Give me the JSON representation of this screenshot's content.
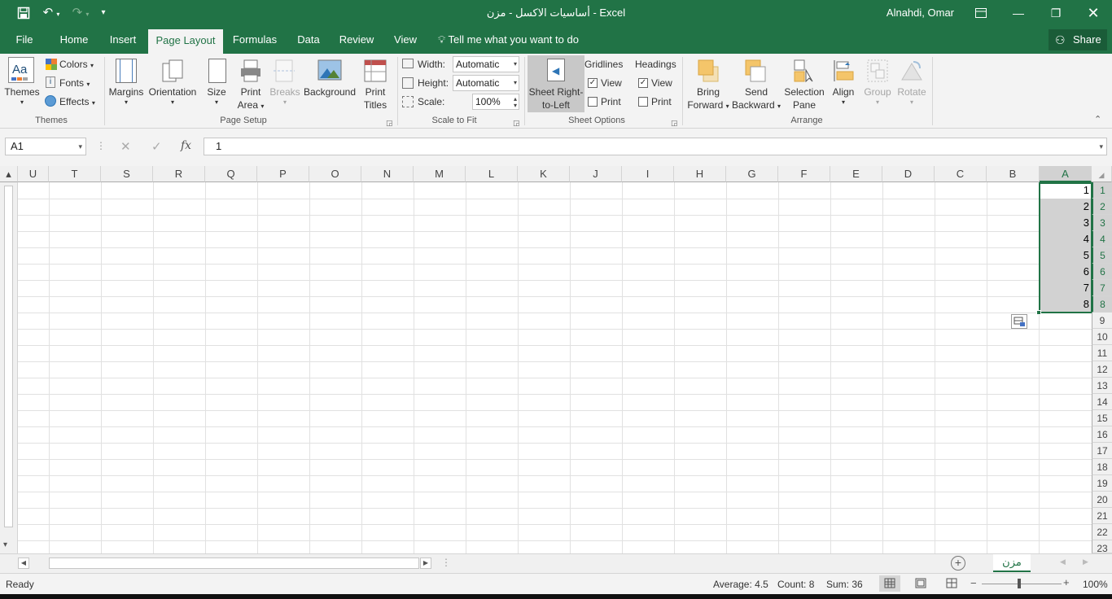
{
  "titlebar": {
    "title": "أساسيات الاكسل - مزن - Excel",
    "user": "Alnahdi, Omar"
  },
  "tabs": [
    {
      "label": "File"
    },
    {
      "label": "Home"
    },
    {
      "label": "Insert"
    },
    {
      "label": "Page Layout"
    },
    {
      "label": "Formulas"
    },
    {
      "label": "Data"
    },
    {
      "label": "Review"
    },
    {
      "label": "View"
    }
  ],
  "tell_me": "Tell me what you want to do",
  "share_label": "Share",
  "ribbon": {
    "themes": {
      "themes_label": "Themes",
      "colors": "Colors",
      "fonts": "Fonts",
      "effects": "Effects",
      "group": "Themes"
    },
    "page_setup": {
      "margins": "Margins",
      "orientation": "Orientation",
      "size": "Size",
      "print_area_1": "Print",
      "print_area_2": "Area",
      "breaks": "Breaks",
      "background": "Background",
      "print_titles_1": "Print",
      "print_titles_2": "Titles",
      "group": "Page Setup"
    },
    "scale_to_fit": {
      "width_label": "Width:",
      "width_value": "Automatic",
      "height_label": "Height:",
      "height_value": "Automatic",
      "scale_label": "Scale:",
      "scale_value": "100%",
      "group": "Scale to Fit"
    },
    "sheet_options": {
      "rtl_1": "Sheet Right-",
      "rtl_2": "to-Left",
      "gridlines": "Gridlines",
      "headings": "Headings",
      "view": "View",
      "print": "Print",
      "group": "Sheet Options"
    },
    "arrange": {
      "bring_1": "Bring",
      "bring_2": "Forward",
      "send_1": "Send",
      "send_2": "Backward",
      "selection_1": "Selection",
      "selection_2": "Pane",
      "align": "Align",
      "group_btn": "Group",
      "rotate": "Rotate",
      "group": "Arrange"
    }
  },
  "formula": {
    "namebox": "A1",
    "fx": "fx",
    "value": "1"
  },
  "columns": [
    "U",
    "T",
    "S",
    "R",
    "Q",
    "P",
    "O",
    "N",
    "M",
    "L",
    "K",
    "J",
    "I",
    "H",
    "G",
    "F",
    "E",
    "D",
    "C",
    "B",
    "A"
  ],
  "rows": [
    "1",
    "2",
    "3",
    "4",
    "5",
    "6",
    "7",
    "8",
    "9",
    "10",
    "11",
    "12",
    "13",
    "14",
    "15",
    "16",
    "17",
    "18",
    "19",
    "20",
    "21",
    "22",
    "23"
  ],
  "cells_a": [
    "1",
    "2",
    "3",
    "4",
    "5",
    "6",
    "7",
    "8"
  ],
  "sheet_tab": "مزن",
  "status": {
    "ready": "Ready",
    "average": "Average: 4.5",
    "count": "Count: 8",
    "sum": "Sum: 36",
    "zoom": "100%"
  },
  "colors": {
    "accent": "#217346",
    "selection": "#d2d2d2"
  }
}
